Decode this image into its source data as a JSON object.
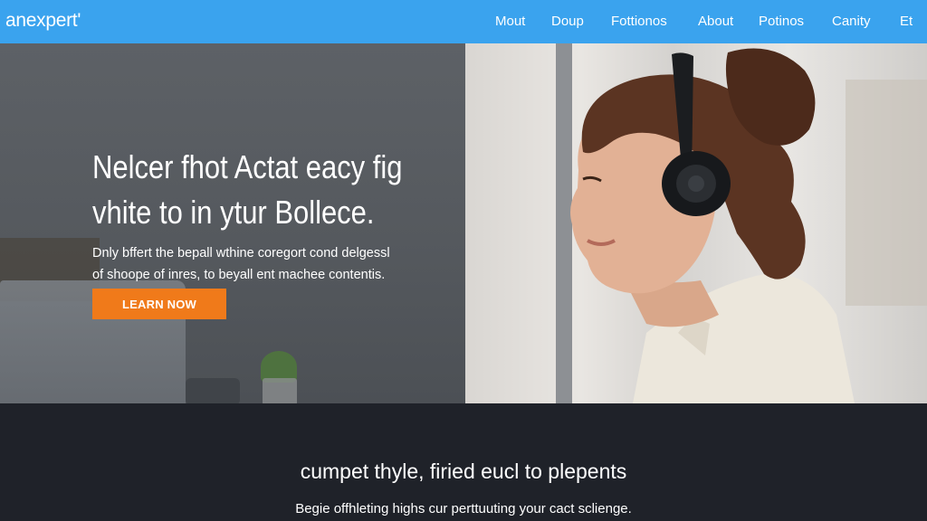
{
  "nav": {
    "logo": "anexpert'",
    "links": [
      "Mout",
      "Doup",
      "Fottionos",
      "About",
      "Potinos",
      "Canity",
      "Et"
    ]
  },
  "hero": {
    "title_lines": [
      "Nelcer fhot Actat eacy fig",
      "vhite to in ytur Bollece."
    ],
    "description_lines": [
      "Dnly bffert the bepall wthine coregort cond delgessl",
      "of shoope of inres, to beyall ent machee contentis."
    ],
    "cta_label": "LEARN NOW"
  },
  "section": {
    "title": "cumpet thyle, firied eucl to plepents",
    "subtitle": "Begie offhleting highs cur perttuuting your cact sclienge."
  },
  "colors": {
    "nav_bg": "#3aa3ee",
    "cta_bg": "#f07a1a",
    "dark_section_bg": "#1f2229"
  }
}
